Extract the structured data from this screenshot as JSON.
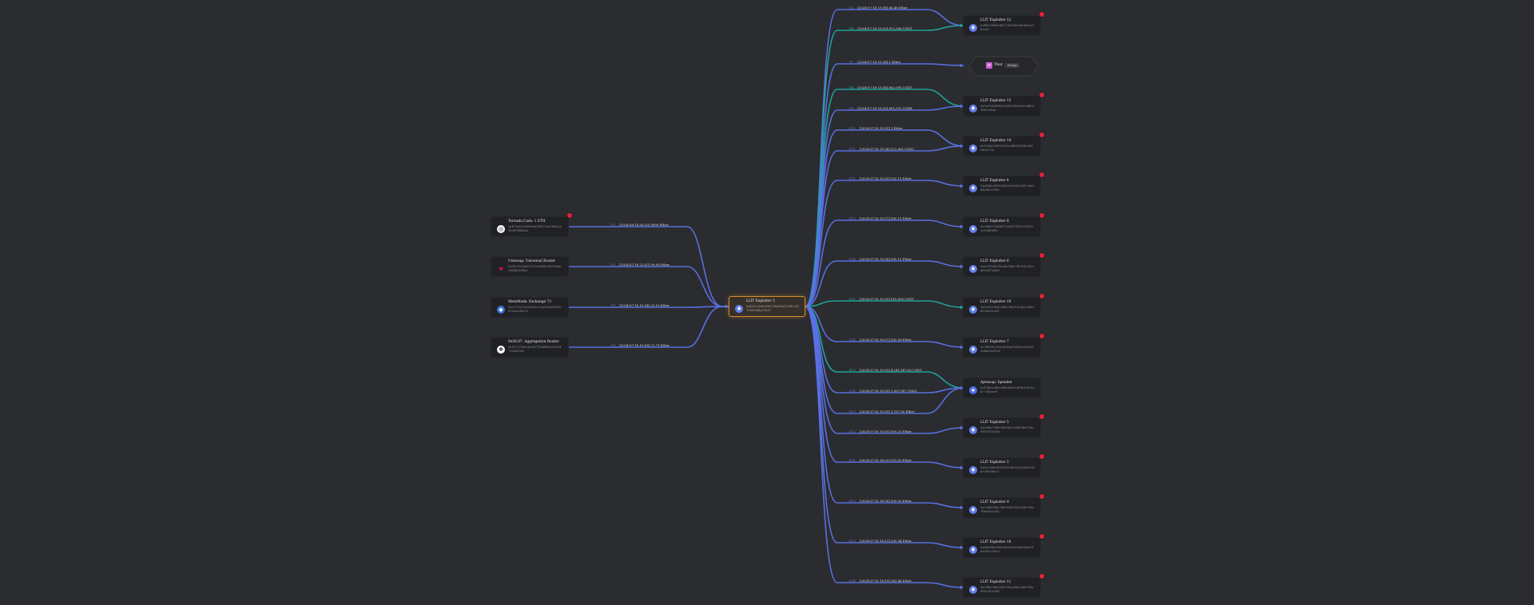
{
  "colors": {
    "background": "#2b2c30",
    "node": "#202124",
    "edge_blue": "#5b73e8",
    "edge_teal": "#1fa89f",
    "focus": "#d98a2e",
    "warning": "#e0243a"
  },
  "center": {
    "name": "LLIT Exploiter 3",
    "address": "0x4033cb8ec88075b69ba2259fcc45708628f6a07b1f",
    "icon": "ethereum-icon"
  },
  "sources": [
    {
      "name": "Tornado.Cash: 1 ETH",
      "address": "0x47ce0c6ed5b0ebd0d122a59d63ce9f2d05fd4a2a",
      "icon": "tornado-icon",
      "edge_id": "E1",
      "edge_label": "[2024-06-14 00:33] 9000 Ether",
      "warning": true
    },
    {
      "name": "Uniswap: Universal Router",
      "address": "0x3fc91a3afd70395cd496c647d5a6cc9d4b2b7fad",
      "icon": "uniswap-icon",
      "edge_id": "E2",
      "edge_label": "[2024-07-16 22:57] 99.00 Ether",
      "warning": false
    },
    {
      "name": "MetaMask: Exchange 73",
      "address": "0x227c5a7ec6d2f2ec53a80ebd3f5f5b1d2e6d3b7e",
      "icon": "metamask-icon",
      "edge_id": "E3",
      "edge_label": "[2024-07-16 15:54] 25.53 Ether",
      "warning": false
    },
    {
      "name": "0x26:87: Aggregation Router",
      "address": "0x1111254eeb25477b68fb85ed929f73a960582",
      "icon": "oneinch-icon",
      "edge_id": "E4",
      "edge_label": "[2024-07-16 15:08] 72.79 Ether",
      "warning": false
    }
  ],
  "targets": [
    {
      "kind": "node",
      "name": "LLIT Exploiter 12",
      "address": "0x4b1c9f5b9d6172b903fe2bcf4e3a9b5a6c",
      "icon": "ethereum-icon",
      "warning": true,
      "edges": [
        {
          "id": "E5",
          "label": "[2024-07-16 15:58] 46.46 Ether",
          "color": "blue"
        },
        {
          "id": "E6",
          "label": "[2024-07-16 15:59] 872,566 USDT",
          "color": "teal"
        }
      ]
    },
    {
      "kind": "hexagon",
      "name": "Thor",
      "tag": "Bridge",
      "icon": "bridge-icon",
      "edges": [
        {
          "id": "E7",
          "label": "[2024-07-16 15:38] 1 Ether",
          "color": "blue"
        }
      ]
    },
    {
      "kind": "node",
      "name": "LLIT Exploiter 15",
      "address": "0x5a01d5d6f0e283f91ddaa383a4b5c5f662d1ab",
      "icon": "ethereum-icon",
      "warning": true,
      "edges": [
        {
          "id": "E8",
          "label": "[2024-07-16 15:38] 602,095 USDT",
          "color": "teal"
        },
        {
          "id": "E9",
          "label": "[2024-07-16 15:39] 801,502 USDK",
          "color": "blue"
        }
      ]
    },
    {
      "kind": "node",
      "name": "LLIT Exploiter 14",
      "address": "0x1e54c55d03e18ac8db9d1bf6c8b1e8ea7c1a",
      "icon": "ethereum-icon",
      "warning": true,
      "edges": [
        {
          "id": "E10",
          "label": "[2024-07-16 15:55] 1 Ether",
          "color": "blue"
        },
        {
          "id": "E11",
          "label": "[2024-07-16 15:36] 872,561 USDC",
          "color": "blue"
        }
      ]
    },
    {
      "kind": "node",
      "name": "LLIT Exploiter 4",
      "address": "0xa1b4e2f0d7a6b3c9e8d1fa2b7c6e5d4a3b2c1f0e",
      "icon": "ethereum-icon",
      "warning": true,
      "edges": [
        {
          "id": "E12",
          "label": "[2024-07-16 15:59] 532.11 Ether",
          "color": "blue"
        }
      ]
    },
    {
      "kind": "node",
      "name": "LLIT Exploiter 8",
      "address": "0x2d86c138b6912e6d07f1a7c3b81e2c6a4f0d9b",
      "icon": "ethereum-icon",
      "warning": true,
      "edges": [
        {
          "id": "E13",
          "label": "[2024-07-16 15:57] 500.11 Ether",
          "color": "blue"
        }
      ]
    },
    {
      "kind": "node",
      "name": "LLIT Exploiter 6",
      "address": "0x6c3f7d9e1b2a4c5d6e7f8091a2b3c4d5e6f7a8b9",
      "icon": "ethereum-icon",
      "warning": true,
      "edges": [
        {
          "id": "E14",
          "label": "[2024-07-16 15:56] 500.11 Ether",
          "color": "blue"
        }
      ]
    },
    {
      "kind": "node",
      "name": "LLIT Exploiter 19",
      "address": "0x9e1f2a3b4c5d6e7f8091a2b3c4d5e6f7a8b9c0d1",
      "icon": "ethereum-icon",
      "warning": true,
      "edges": [
        {
          "id": "E15",
          "label": "[2024-07-16 15:59] 810,430 USDT",
          "color": "teal"
        }
      ]
    },
    {
      "kind": "node",
      "name": "LLIT Exploiter 7",
      "address": "0x7f8091a2b3c4d5e6f7a8b9c0d1e2f3a4b5c6d7e8",
      "icon": "ethereum-icon",
      "warning": true,
      "edges": [
        {
          "id": "E16",
          "label": "[2024-07-16 16:07] 500.58 Ether",
          "color": "blue"
        }
      ]
    },
    {
      "kind": "node",
      "name": "Aptswap: Spender",
      "address": "0x194a2e4f8c96ba6d69e4f9b10b12a8c70d3ae9f",
      "icon": "aptswap-icon",
      "warning": false,
      "edges": [
        {
          "id": "E17",
          "label": "[2024-07-16 15:59] 4,241,567.63 USDT",
          "color": "teal"
        },
        {
          "id": "E18",
          "label": "[2024-07-16 15:59] 1,007,907 USDC",
          "color": "blue"
        },
        {
          "id": "E19",
          "label": "[2024-07-16 15:59] 1,767.90 Ether",
          "color": "blue"
        }
      ]
    },
    {
      "kind": "node",
      "name": "LLIT Exploiter 5",
      "address": "0xa5b6c7d8e9f0a1b2c3d4e5f6a7b8c9d0e1f2a3b4",
      "icon": "ethereum-icon",
      "warning": true,
      "edges": [
        {
          "id": "E20",
          "label": "[2024-07-16 15:59] 500.31 Ether",
          "color": "blue"
        }
      ]
    },
    {
      "kind": "node",
      "name": "LLIT Exploiter 2",
      "address": "0xb2c3d4e5f6a7b8c9d0e1f2a3b4c5d6e7f8a9b0c1",
      "icon": "ethereum-icon",
      "warning": true,
      "edges": [
        {
          "id": "E21",
          "label": "[2024-07-16 16:03] 501.00 Ether",
          "color": "blue"
        }
      ]
    },
    {
      "kind": "node",
      "name": "LLIT Exploiter 9",
      "address": "0xc3d4e5f6a7b8c9d0e1f2a3b4c5d6e7f8a9b0c1d2",
      "icon": "ethereum-icon",
      "warning": true,
      "edges": [
        {
          "id": "E22",
          "label": "[2024-07-16 16:08] 500.00 Ether",
          "color": "blue"
        }
      ]
    },
    {
      "kind": "node",
      "name": "LLIT Exploiter 10",
      "address": "0xd4e5f6a7b8c9d0e1f2a3b4c5d6e7f8a9b0c1d2e3",
      "icon": "ethereum-icon",
      "warning": true,
      "edges": [
        {
          "id": "E23",
          "label": "[2024-07-16 16:13] 200.54 Ether",
          "color": "blue"
        }
      ]
    },
    {
      "kind": "node",
      "name": "LLIT Exploiter 11",
      "address": "0xe5f6a7b8c9d0e1f2a3b4c5d6e7f8a9b0c1d2e3f4",
      "icon": "ethereum-icon",
      "warning": true,
      "edges": [
        {
          "id": "E24",
          "label": "[2024-07-16 16:19] 163.44 Ether",
          "color": "blue"
        }
      ]
    }
  ]
}
